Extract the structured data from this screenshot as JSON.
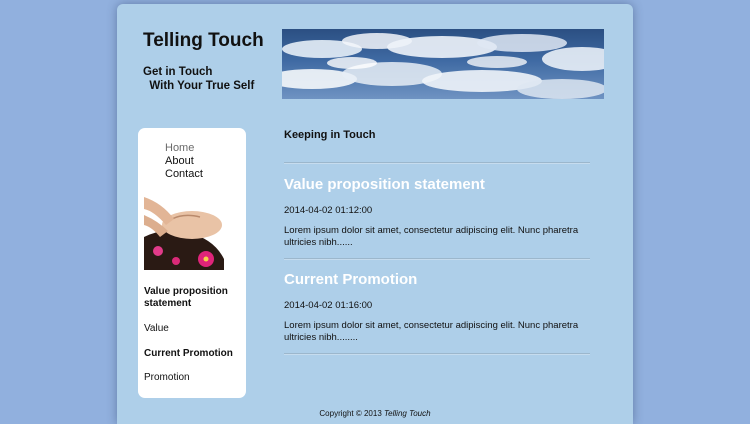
{
  "header": {
    "site_title": "Telling Touch",
    "tagline": "Get in Touch\n  With Your True Self"
  },
  "sidebar": {
    "nav": [
      {
        "label": "Home",
        "active": true
      },
      {
        "label": "About",
        "active": false
      },
      {
        "label": "Contact",
        "active": false
      }
    ],
    "sections": [
      {
        "heading": "Value proposition statement",
        "text": "Value"
      },
      {
        "heading": "Current Promotion",
        "text": "Promotion"
      }
    ]
  },
  "main": {
    "heading": "Keeping in Touch",
    "posts": [
      {
        "title": "Value proposition statement",
        "date": "2014-04-02 01:12:00",
        "excerpt": "Lorem ipsum dolor sit amet, consectetur adipiscing elit. Nunc pharetra ultricies nibh......"
      },
      {
        "title": "Current Promotion",
        "date": "2014-04-02 01:16:00",
        "excerpt": "Lorem ipsum dolor sit amet, consectetur adipiscing elit. Nunc pharetra ultricies nibh........"
      }
    ]
  },
  "footer": {
    "copyright": "Copyright © 2013",
    "brand": "Telling Touch"
  },
  "colors": {
    "page_background": "#91b0de",
    "content_background": "#aecfe9",
    "post_title": "#ffffff"
  }
}
